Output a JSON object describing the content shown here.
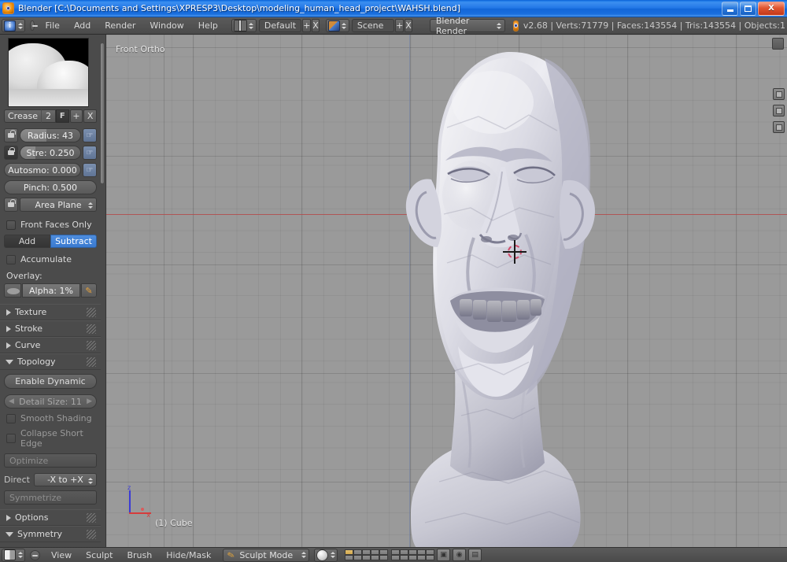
{
  "window": {
    "title": "Blender [C:\\Documents and Settings\\XPRESP3\\Desktop\\modeling_human_head_project\\WAHSH.blend]",
    "minimize_label": "_",
    "maximize_label": "□",
    "close_label": "X"
  },
  "topbar": {
    "editor_icon": "info-editor-icon",
    "menus": [
      "File",
      "Add",
      "Render",
      "Window",
      "Help"
    ],
    "screen_layout": "Default",
    "add_screen_label": "+",
    "delete_screen_label": "X",
    "scene_name": "Scene",
    "add_scene_label": "+",
    "delete_scene_label": "X",
    "render_engine": "Blender Render",
    "stats": "v2.68 | Verts:71779 | Faces:143554 | Tris:143554 | Objects:1"
  },
  "toolshelf": {
    "brush": {
      "name": "Crease",
      "count": "2",
      "fake_user": "F",
      "add_label": "+",
      "delete_label": "X"
    },
    "sliders": [
      {
        "label": "Radius: 43",
        "fill": 43,
        "locked": false
      },
      {
        "label": "Stre: 0.250",
        "fill": 25,
        "locked": true
      },
      {
        "label": "Autosmo: 0.000",
        "fill": 0,
        "locked": false
      },
      {
        "label": "Pinch: 0.500",
        "fill": 0,
        "locked": null
      }
    ],
    "plane_select": "Area Plane",
    "front_faces_only": "Front Faces Only",
    "direction_add": "Add",
    "direction_subtract": "Subtract",
    "direction_active": "Subtract",
    "accumulate": "Accumulate",
    "overlay_label": "Overlay:",
    "overlay_alpha": "Alpha: 1%",
    "panels": [
      {
        "title": "Texture",
        "open": false
      },
      {
        "title": "Stroke",
        "open": false
      },
      {
        "title": "Curve",
        "open": false
      },
      {
        "title": "Topology",
        "open": true
      },
      {
        "title": "Options",
        "open": false
      },
      {
        "title": "Symmetry",
        "open": true
      }
    ],
    "topology": {
      "enable_dynamic": "Enable Dynamic",
      "detail_size": "Detail Size: 11",
      "smooth_shading": "Smooth Shading",
      "collapse_short_edge": "Collapse Short Edge",
      "optimize": "Optimize",
      "direction_label": "Direct",
      "direction_value": "-X to +X",
      "symmetrize": "Symmetrize"
    }
  },
  "viewport": {
    "view_label": "Front Ortho",
    "object_label": "(1) Cube",
    "axis_z": "z",
    "axis_x": "x",
    "colors": {
      "background": "#9a9a9a",
      "axis_x_line": "#b34a4a",
      "axis_z_line": "#6f7fa8",
      "mesh_light": "#e8e8ee",
      "mesh_mid": "#b8b8c6",
      "mesh_shadow": "#8d8d9e"
    }
  },
  "bottombar": {
    "editor_icon": "3d-view-icon",
    "menus": [
      "View",
      "Sculpt",
      "Brush",
      "Hide/Mask"
    ],
    "mode": "Sculpt Mode",
    "shading": "solid-shading-icon",
    "icons": [
      "render-preview-icon",
      "camera-icon",
      "render-animation-icon"
    ]
  }
}
